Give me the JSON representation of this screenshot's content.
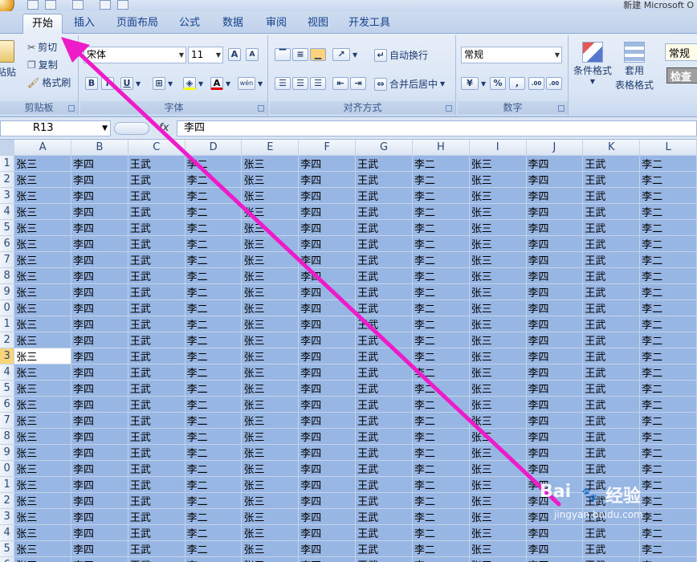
{
  "window": {
    "title": "新建 Microsoft O"
  },
  "tabs": [
    {
      "label": "开始",
      "active": true
    },
    {
      "label": "插入"
    },
    {
      "label": "页面布局"
    },
    {
      "label": "公式"
    },
    {
      "label": "数据"
    },
    {
      "label": "审阅"
    },
    {
      "label": "视图"
    },
    {
      "label": "开发工具"
    }
  ],
  "clipboard": {
    "paste": "粘贴",
    "cut": "剪切",
    "copy": "复制",
    "format_painter": "格式刷",
    "label": "剪贴板"
  },
  "font": {
    "name": "宋体",
    "size": "11",
    "bold": "B",
    "italic": "I",
    "underline": "U",
    "label": "字体",
    "grow": "A",
    "shrink": "A",
    "phonetic": "wén"
  },
  "alignment": {
    "wrap": "自动换行",
    "merge": "合并后居中",
    "label": "对齐方式"
  },
  "number": {
    "format": "常规",
    "percent": "%",
    "comma": ",",
    "label": "数字",
    "inc_decimal": ".00",
    "dec_decimal": ".00"
  },
  "styles": {
    "conditional": "条件格式",
    "table_1": "套用",
    "table_2": "表格格式",
    "normal": "常规",
    "check": "检查"
  },
  "formula_bar": {
    "name_box": "R13",
    "fx": "fx",
    "value": "李四"
  },
  "columns": [
    "A",
    "B",
    "C",
    "D",
    "E",
    "F",
    "G",
    "H",
    "I",
    "J",
    "K",
    "L"
  ],
  "row_numbers": [
    "1",
    "2",
    "3",
    "4",
    "5",
    "6",
    "7",
    "8",
    "9",
    "0",
    "1",
    "2",
    "3",
    "4",
    "5",
    "6",
    "7",
    "8",
    "9",
    "0",
    "1",
    "2",
    "3",
    "4",
    "5",
    "6",
    "7"
  ],
  "pattern": [
    "张三",
    "李四",
    "王武",
    "李二"
  ],
  "active_row_index": 12,
  "active_col_index": 0,
  "watermark": {
    "brand": "Bai",
    "suffix": "经验",
    "url": "jingyan.baidu.com"
  },
  "colors": {
    "selection": "#98b6e4",
    "arrow": "#ee1bc8",
    "ribbon": "#dbe6f5"
  }
}
